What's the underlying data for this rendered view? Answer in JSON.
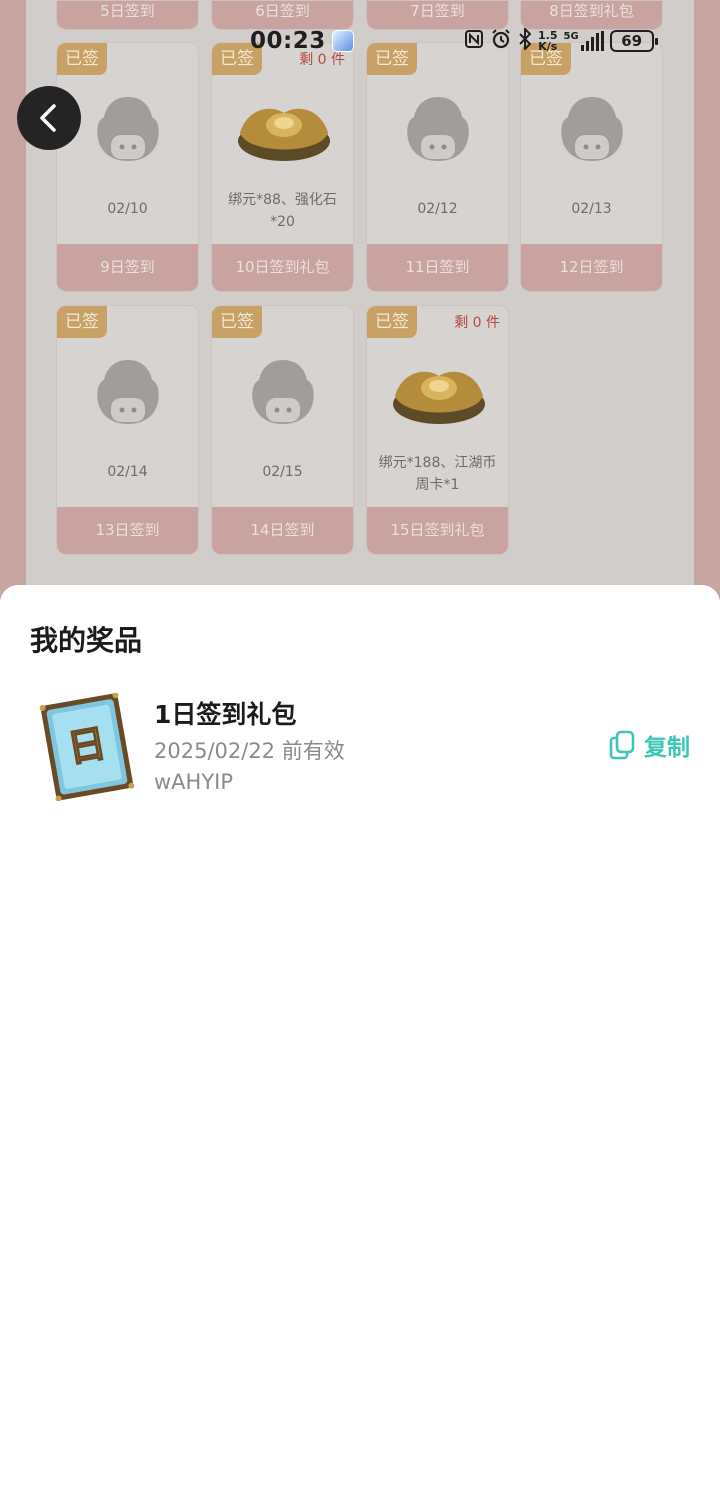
{
  "status_bar": {
    "time": "00:23",
    "speed_top": "1.5",
    "speed_bottom": "K/s",
    "network": "5G",
    "battery": "69"
  },
  "top_row_labels": [
    "5日签到",
    "6日签到",
    "7日签到",
    "8日签到礼包"
  ],
  "cards_row2": [
    {
      "badge": "已签",
      "date": "02/10",
      "label": "9日签到",
      "type": "mascot"
    },
    {
      "badge": "已签",
      "remain": "剩 0 件",
      "desc": "绑元*88、强化石*20",
      "label": "10日签到礼包",
      "type": "gold"
    },
    {
      "badge": "已签",
      "date": "02/12",
      "label": "11日签到",
      "type": "mascot"
    },
    {
      "badge": "已签",
      "date": "02/13",
      "label": "12日签到",
      "type": "mascot"
    }
  ],
  "cards_row3": [
    {
      "badge": "已签",
      "date": "02/14",
      "label": "13日签到",
      "type": "mascot"
    },
    {
      "badge": "已签",
      "date": "02/15",
      "label": "14日签到",
      "type": "mascot"
    },
    {
      "badge": "已签",
      "remain": "剩 0 件",
      "desc": "绑元*188、江湖币周卡*1",
      "label": "15日签到礼包",
      "type": "gold"
    }
  ],
  "sheet": {
    "title": "我的奖品",
    "prize": {
      "name": "1日签到礼包",
      "expiry": "2025/02/22 前有效",
      "code": "wAHYIP",
      "card_glyph": "日"
    },
    "copy_label": "复制",
    "accent_color": "#3cc6b5"
  },
  "icons": [
    "back-arrow-icon",
    "copy-icon",
    "nfc-icon",
    "alarm-icon",
    "bluetooth-icon",
    "signal-icon",
    "battery-icon"
  ]
}
